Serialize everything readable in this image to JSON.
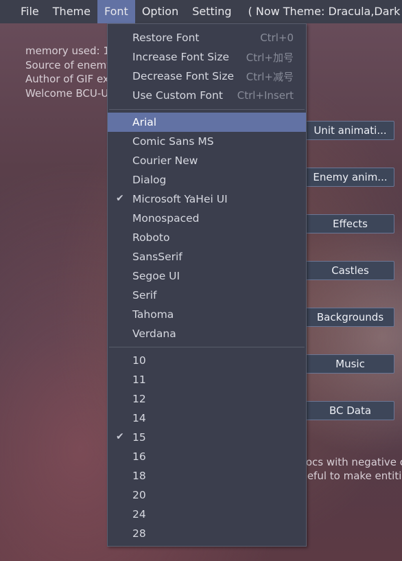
{
  "menubar": {
    "items": [
      {
        "label": "File",
        "active": false
      },
      {
        "label": "Theme",
        "active": false
      },
      {
        "label": "Font",
        "active": true
      },
      {
        "label": "Option",
        "active": false
      },
      {
        "label": "Setting",
        "active": false
      }
    ],
    "theme_note": "( Now Theme: Dracula,Dark )"
  },
  "background": {
    "lines": [
      "memory used: 1",
      "Source of enemy",
      "Author of GIF ex",
      "Welcome BCU-U"
    ],
    "lines_right": [
      "rocs with negative c",
      "seful to make entiti"
    ]
  },
  "side_buttons": [
    "Unit animati...",
    "Enemy anim...",
    "Effects",
    "Castles",
    "Backgrounds",
    "Music",
    "BC Data"
  ],
  "font_menu": {
    "actions": [
      {
        "label": "Restore Font",
        "shortcut": "Ctrl+0"
      },
      {
        "label": "Increase Font Size",
        "shortcut": "Ctrl+加号"
      },
      {
        "label": "Decrease Font Size",
        "shortcut": "Ctrl+减号"
      },
      {
        "label": "Use Custom Font",
        "shortcut": "Ctrl+Insert"
      }
    ],
    "fonts": [
      {
        "label": "Arial",
        "checked": false,
        "highlighted": true
      },
      {
        "label": "Comic Sans MS",
        "checked": false,
        "highlighted": false
      },
      {
        "label": "Courier New",
        "checked": false,
        "highlighted": false
      },
      {
        "label": "Dialog",
        "checked": false,
        "highlighted": false
      },
      {
        "label": "Microsoft YaHei UI",
        "checked": true,
        "highlighted": false
      },
      {
        "label": "Monospaced",
        "checked": false,
        "highlighted": false
      },
      {
        "label": "Roboto",
        "checked": false,
        "highlighted": false
      },
      {
        "label": "SansSerif",
        "checked": false,
        "highlighted": false
      },
      {
        "label": "Segoe UI",
        "checked": false,
        "highlighted": false
      },
      {
        "label": "Serif",
        "checked": false,
        "highlighted": false
      },
      {
        "label": "Tahoma",
        "checked": false,
        "highlighted": false
      },
      {
        "label": "Verdana",
        "checked": false,
        "highlighted": false
      }
    ],
    "sizes": [
      {
        "label": "10",
        "checked": false
      },
      {
        "label": "11",
        "checked": false
      },
      {
        "label": "12",
        "checked": false
      },
      {
        "label": "14",
        "checked": false
      },
      {
        "label": "15",
        "checked": true
      },
      {
        "label": "16",
        "checked": false
      },
      {
        "label": "18",
        "checked": false
      },
      {
        "label": "20",
        "checked": false
      },
      {
        "label": "24",
        "checked": false
      },
      {
        "label": "28",
        "checked": false
      }
    ],
    "check_glyph": "✔"
  },
  "colors": {
    "menubar_bg": "#3c3f4c",
    "accent": "#6272a4",
    "dropdown_bg": "#3b3e4d"
  }
}
